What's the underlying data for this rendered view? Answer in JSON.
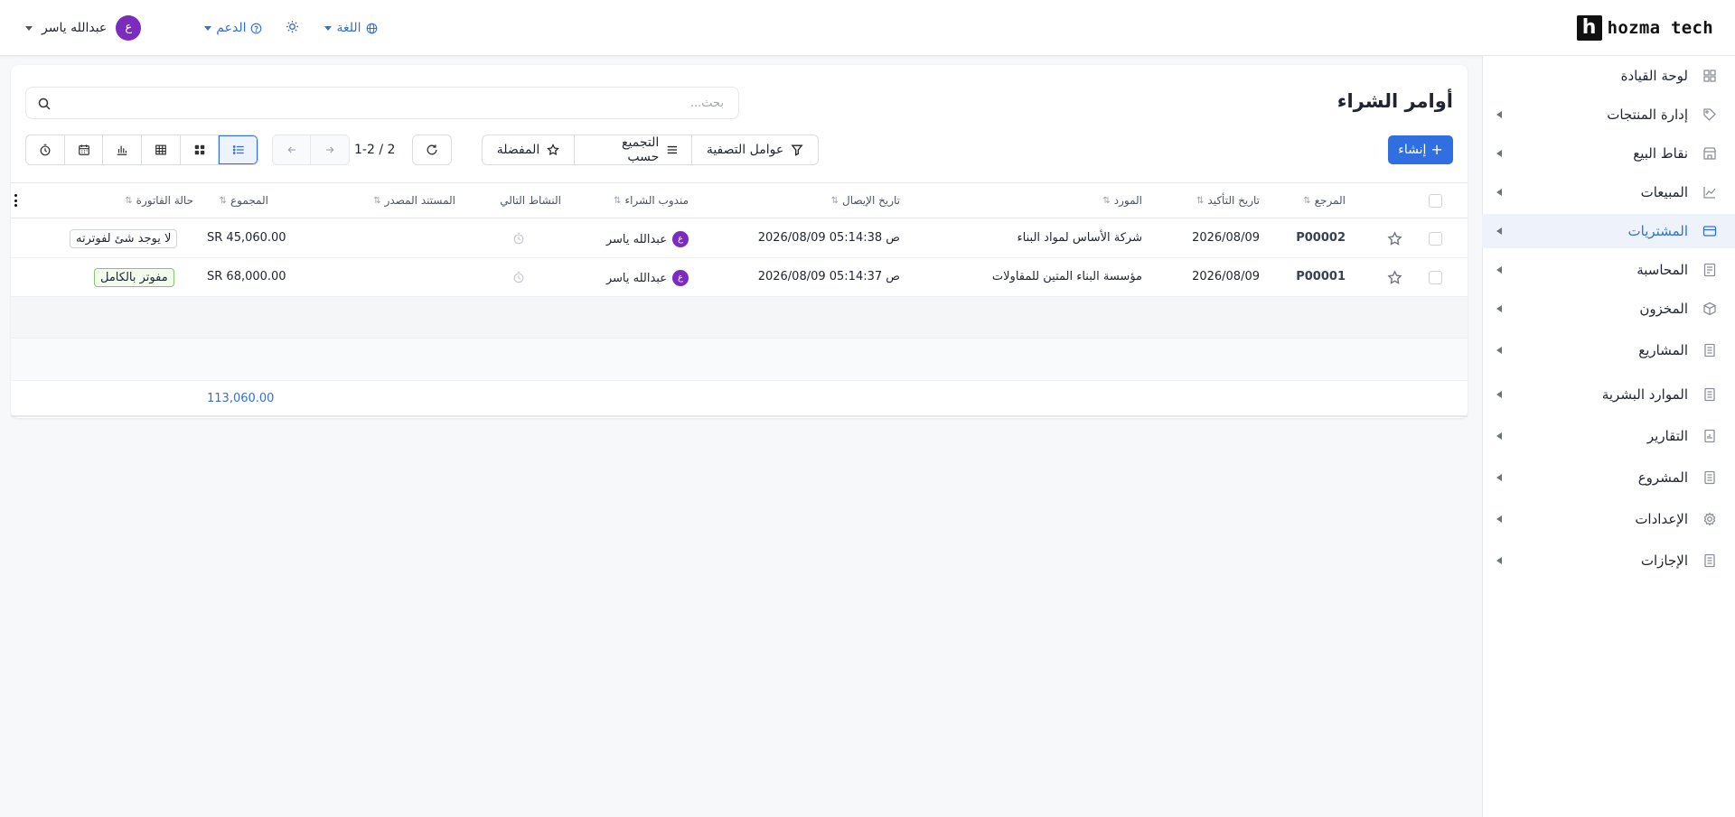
{
  "brand": {
    "name": "hozma tech",
    "mark": "h"
  },
  "topbar": {
    "user_name": "عبدالله ياسر",
    "user_initial": "ع",
    "support_label": "الدعم",
    "language_label": "اللغة"
  },
  "sidebar": {
    "items": [
      {
        "label": "لوحة القيادة",
        "icon": "dashboard-icon"
      },
      {
        "label": "إدارة المنتجات",
        "icon": "tag-icon"
      },
      {
        "label": "نقاط البيع",
        "icon": "store-icon"
      },
      {
        "label": "المبيعات",
        "icon": "trend-icon"
      },
      {
        "label": "المشتريات",
        "icon": "card-icon",
        "active": true
      },
      {
        "label": "المحاسبة",
        "icon": "ledger-icon"
      },
      {
        "label": "المخزون",
        "icon": "box-icon"
      },
      {
        "label": "المشاريع",
        "icon": "document-icon"
      },
      {
        "label": "الموارد البشرية",
        "icon": "document-icon"
      },
      {
        "label": "التقارير",
        "icon": "report-icon"
      },
      {
        "label": "المشروع",
        "icon": "document-icon"
      },
      {
        "label": "الإعدادات",
        "icon": "gear-icon"
      },
      {
        "label": "الإجازات",
        "icon": "document-icon"
      }
    ]
  },
  "page": {
    "title": "أوامر الشراء",
    "search_placeholder": "بحث...",
    "create_label": "إنشاء",
    "filters_label": "عوامل التصفية",
    "group_by_label": "التجميع حسب",
    "favorites_label": "المفضلة",
    "pager_text": "1-2 / 2"
  },
  "table": {
    "columns": {
      "reference": "المرجع",
      "confirm_date": "تاريخ التأكيد",
      "vendor": "المورد",
      "delivery_date": "تاريخ الإيصال",
      "buyer": "مندوب الشراء",
      "next_activity": "النشاط التالي",
      "source_doc": "المستند المصدر",
      "total": "المجموع",
      "invoice_status": "حالة الفاتورة"
    },
    "rows": [
      {
        "reference": "P00002",
        "confirm_date": "2026/08/09",
        "vendor": "شركة الأساس لمواد البناء",
        "delivery_date": "2026/08/09 05:14:38 ص",
        "buyer": "عبدالله ياسر",
        "buyer_initial": "ع",
        "total": "SR 45,060.00",
        "invoice_status": "لا يوجد شئ لفوترته",
        "status_kind": "none"
      },
      {
        "reference": "P00001",
        "confirm_date": "2026/08/09",
        "vendor": "مؤسسة البناء المتين للمقاولات",
        "delivery_date": "2026/08/09 05:14:37 ص",
        "buyer": "عبدالله ياسر",
        "buyer_initial": "ع",
        "total": "SR 68,000.00",
        "invoice_status": "مفوتر بالكامل",
        "status_kind": "paid"
      }
    ],
    "grand_total": "113,060.00"
  },
  "colors": {
    "accent": "#2f6fdf",
    "avatar": "#7b2cbf",
    "paid_border": "#86c46d"
  }
}
